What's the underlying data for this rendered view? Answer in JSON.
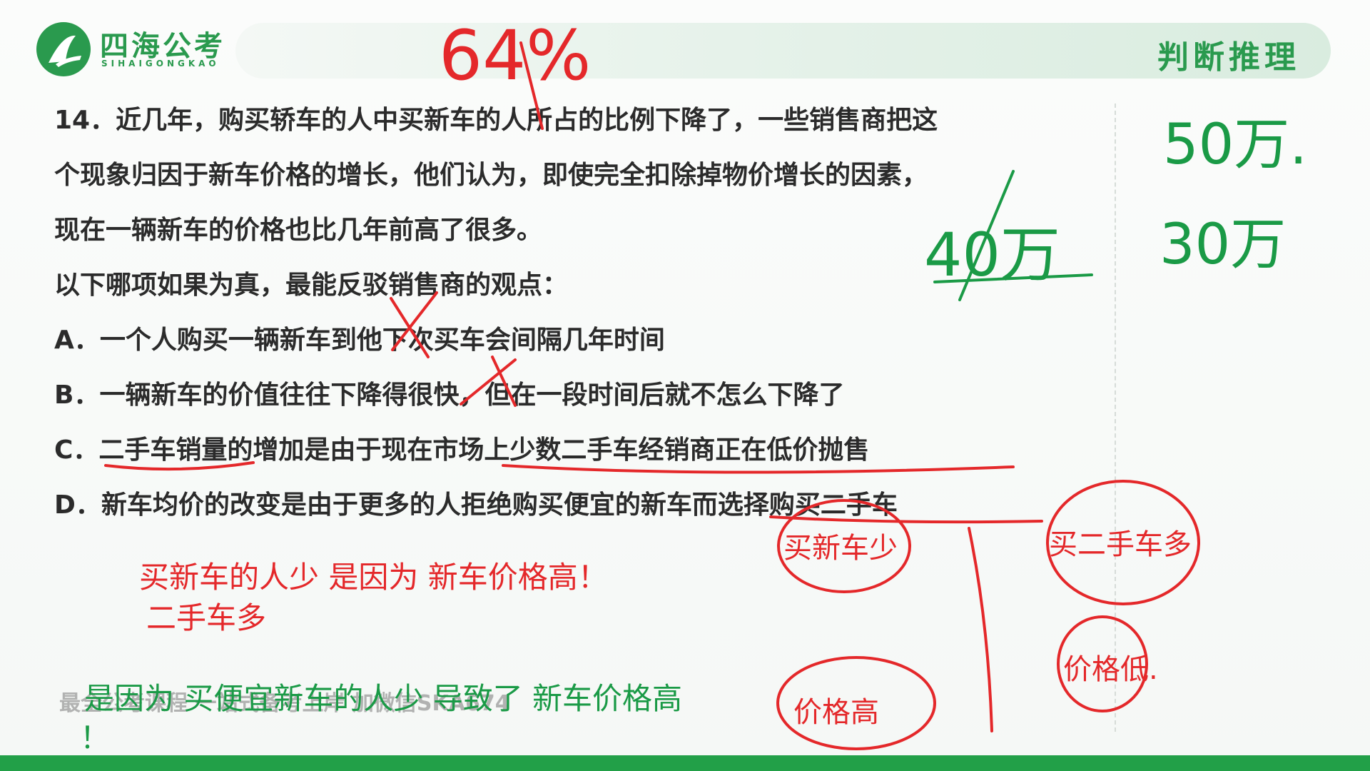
{
  "header": {
    "logo_cn": "四海公考",
    "logo_en": "SIHAIGONGKAO",
    "section_title": "判断推理"
  },
  "question": {
    "stem_lines": [
      "14．近几年，购买轿车的人中买新车的人所占的比例下降了，一些销售商把这",
      "个现象归因于新车价格的增长，他们认为，即使完全扣除掉物价增长的因素，",
      "现在一辆新车的价格也比几年前高了很多。"
    ],
    "prompt": "以下哪项如果为真，最能反驳销售商的观点：",
    "options": [
      {
        "label": "A．",
        "text": "一个人购买一辆新车到他下次买车会间隔几年时间"
      },
      {
        "label": "B．",
        "text": "一辆新车的价值往往下降得很快，但在一段时间后就不怎么下降了"
      },
      {
        "label": "C．",
        "text": "二手车销量的增加是由于现在市场上少数二手车经销商正在低价抛售"
      },
      {
        "label": "D．",
        "text": "新车均价的改变是由于更多的人拒绝购买便宜的新车而选择购买二手车"
      }
    ]
  },
  "annotations": {
    "red_top": "64%",
    "green_right_1": "50万.",
    "green_right_2": "30万",
    "green_mid": "40万",
    "red_line_1": "买新车的人少   是因为  新车价格高！",
    "red_line_2": "二手车多",
    "green_bottom": "是因为 买便宜新车的人少  导致了 新车价格高",
    "green_bottom_excl": "！",
    "circle_1": "买新车少",
    "circle_2": "买二手车多",
    "circle_3": "价格低.",
    "circle_4": "价格高"
  },
  "watermark": "最全公考课程  一站式备考上岸 加微信SKA674",
  "colors": {
    "brand_green": "#2a9a4e",
    "ink_red": "#e4282a",
    "ink_green": "#1a9a46",
    "bottom_bar": "#22a048"
  }
}
